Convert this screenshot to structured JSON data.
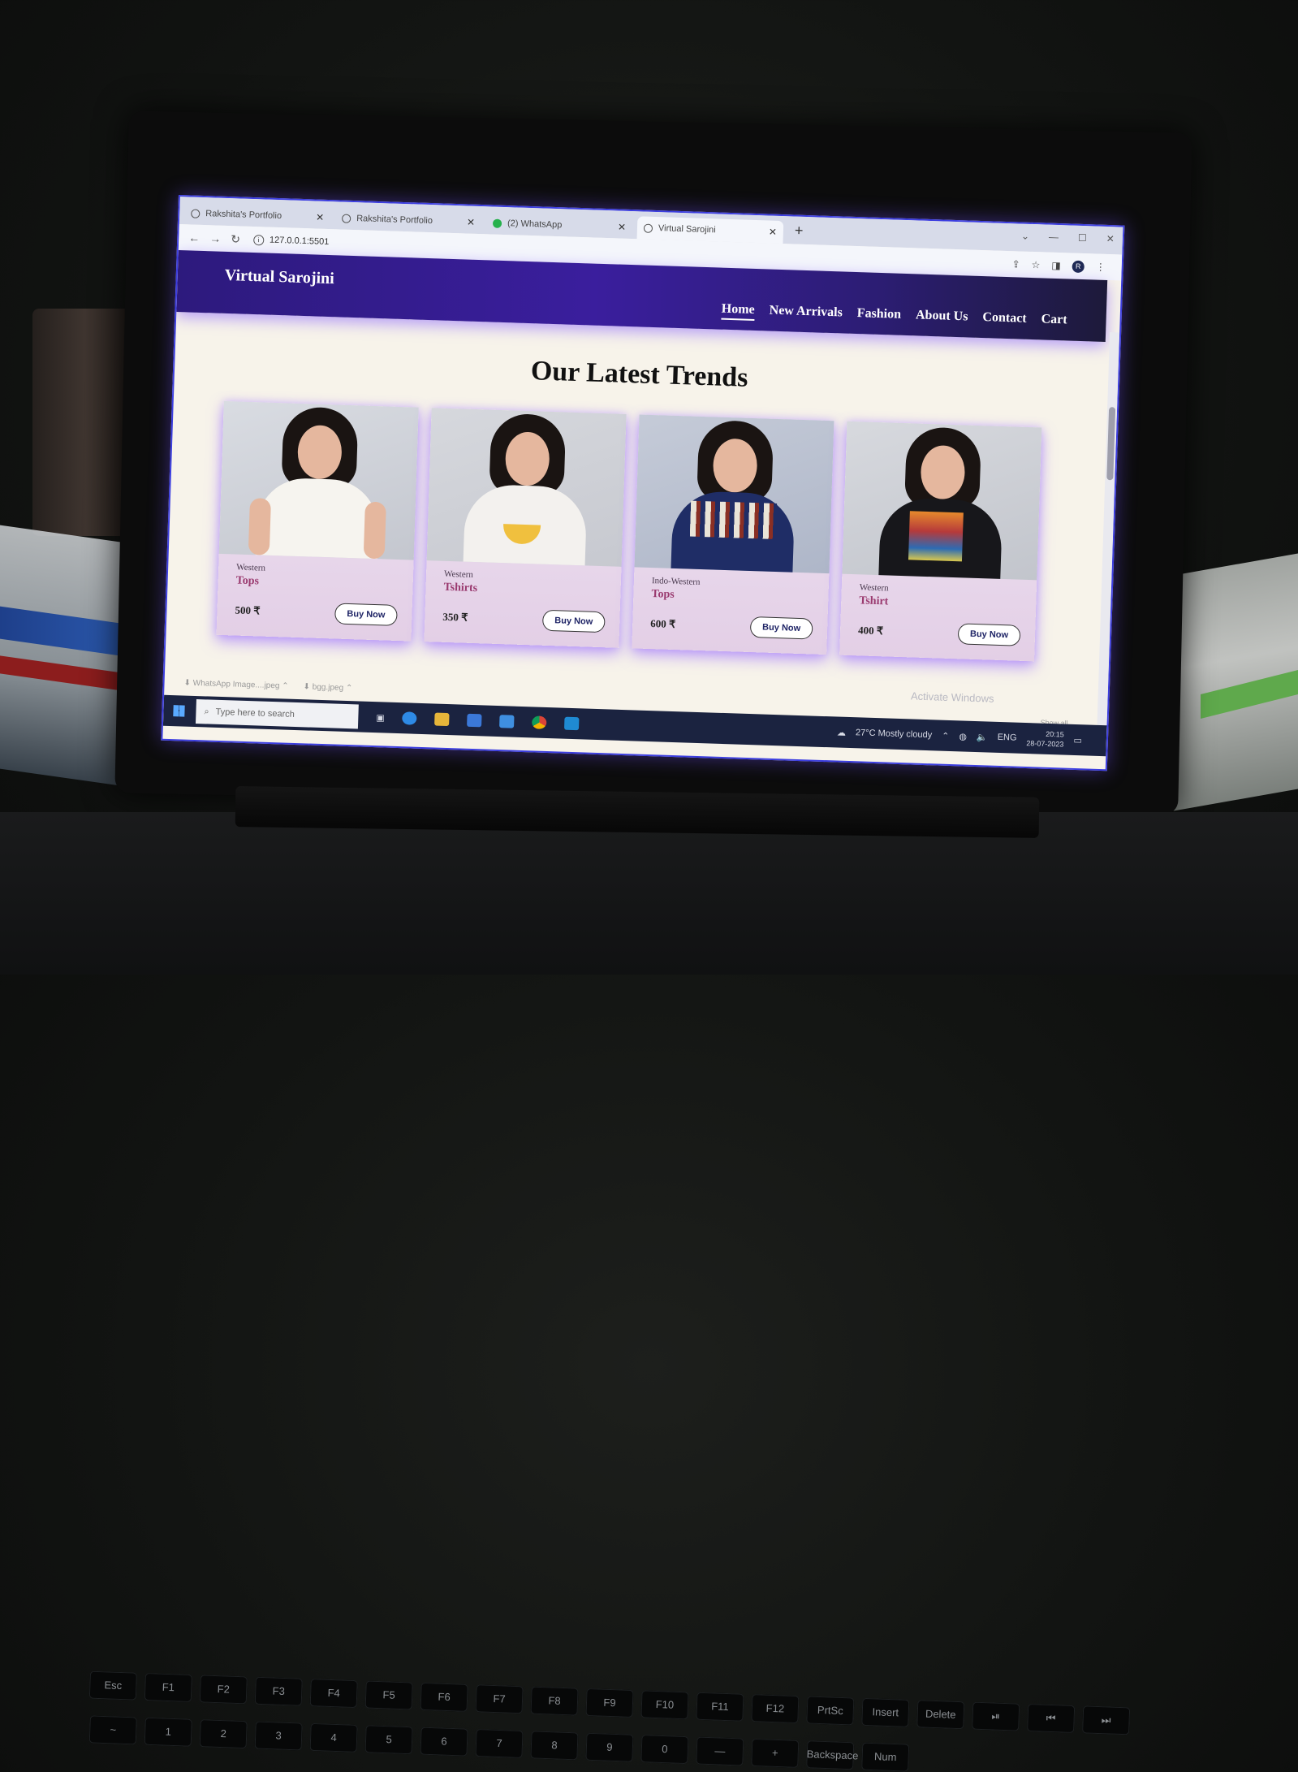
{
  "browser": {
    "tabs": [
      {
        "title": "Rakshita's Portfolio",
        "icon": "globe-icon",
        "active": false
      },
      {
        "title": "Rakshita's Portfolio",
        "icon": "globe-icon",
        "active": false
      },
      {
        "title": "(2) WhatsApp",
        "icon": "whatsapp-icon",
        "active": false
      },
      {
        "title": "Virtual Sarojini",
        "icon": "globe-icon",
        "active": true
      }
    ],
    "new_tab_label": "+",
    "url": "127.0.0.1:5501",
    "profile_initial": "R"
  },
  "site": {
    "brand": "Virtual Sarojini",
    "nav": [
      {
        "label": "Home",
        "active": true
      },
      {
        "label": "New Arrivals",
        "active": false
      },
      {
        "label": "Fashion",
        "active": false
      },
      {
        "label": "About Us",
        "active": false
      },
      {
        "label": "Contact",
        "active": false
      },
      {
        "label": "Cart",
        "active": false
      }
    ],
    "heading": "Our Latest Trends",
    "products": [
      {
        "category": "Western",
        "name": "Tops",
        "price": "500 ₹",
        "button": "Buy Now"
      },
      {
        "category": "Western",
        "name": "Tshirts",
        "price": "350 ₹",
        "button": "Buy Now"
      },
      {
        "category": "Indo-Western",
        "name": "Tops",
        "price": "600 ₹",
        "button": "Buy Now"
      },
      {
        "category": "Western",
        "name": "Tshirt",
        "price": "400 ₹",
        "button": "Buy Now"
      }
    ]
  },
  "downloads": [
    {
      "file": "WhatsApp Image....jpeg"
    },
    {
      "file": "bgg.jpeg"
    }
  ],
  "overlay": {
    "activate": "Activate Windows",
    "show_all": "Show all"
  },
  "taskbar": {
    "search_placeholder": "Type here to search",
    "weather": "27°C  Mostly cloudy",
    "lang": "ENG",
    "time": "20:15",
    "date": "28-07-2023"
  },
  "colors": {
    "nav_start": "#2d1a7d",
    "nav_end": "#1d1a3a",
    "accent_glow": "#9b6bff",
    "product_name": "#9a3a6f"
  }
}
